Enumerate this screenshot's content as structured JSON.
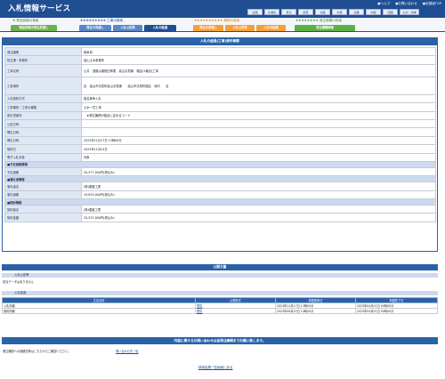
{
  "header": {
    "title": "入札情報サービス",
    "links": [
      "●ヘルプ",
      "●お問い合わせ",
      "●全国版TOP"
    ],
    "regions": [
      "全国",
      "北海道",
      "東北",
      "関東",
      "北陸",
      "中部",
      "近畿",
      "中国",
      "四国",
      "九州・沖縄"
    ]
  },
  "categories": {
    "heads": [
      "★ 物品役務の検索",
      "★★★★★★★★★ 工事の検索",
      "★★★★★★★★★★ 業務の検索",
      "★★★★★★★★ 発注機関の検索"
    ],
    "tabs": [
      "物品役務の発注見通し",
      "発注の見通し",
      "入札公告等",
      "入札の経過",
      "発注の見通し",
      "入札公告等",
      "入札の経過",
      "発注機関情報"
    ]
  },
  "main": {
    "heading": "入札の経過(工事)案件概要",
    "rows": [
      {
        "label": "発注機関",
        "value": "岐阜県"
      },
      {
        "label": "担当課・事務所",
        "value": "高山土木事務所"
      },
      {
        "label": "工事名称",
        "value": "公共　道路災害復旧事業　高山清見線　堀谷(1番目)工事"
      },
      {
        "label": "工事場所",
        "value": "自　高山市清見町高山清見線　　高山市清見町堀谷　地内　　至"
      },
      {
        "label": "入札契約方式",
        "value": "指名競争入札"
      },
      {
        "label": "工事種別／工事の種類",
        "value": "土木一式工事"
      },
      {
        "label": "設計書番号",
        "value": "　★発注機関が独自に定めるコード"
      },
      {
        "label": "公告日時",
        "value": ""
      },
      {
        "label": "開札日時",
        "value": ""
      },
      {
        "label": "開札日時",
        "value": "2023年11月17日 13時00分"
      },
      {
        "label": "契約日",
        "value": "2023年11月24日"
      },
      {
        "label": "電子入札対象",
        "value": "対象"
      }
    ],
    "section_price": "■予定価格情報",
    "price_label": "予定価格",
    "price_value": "20,577,000円(税込み)",
    "section_winner": "■落札者情報",
    "winner_rows": [
      {
        "label": "落札者名",
        "value": "(株)堀渡工業"
      },
      {
        "label": "落札価格",
        "value": "19,635,000円(税込み)"
      }
    ],
    "section_contract": "■契約情報",
    "contract_rows": [
      {
        "label": "契約者名",
        "value": "(株)堀渡工業"
      },
      {
        "label": "契約金額",
        "value": "20,537,000円(税込み)"
      }
    ]
  },
  "docs": {
    "heading": "公開文書",
    "notice_bar": "入札公告等",
    "notice_text": "該当データはありません",
    "result_bar": "入札経過",
    "columns": [
      "文書名称",
      "公開形式",
      "掲載更新日",
      "掲載終了日"
    ],
    "rows": [
      {
        "name": "入札情報",
        "format": "閲覧",
        "updated": "2023年11月17日 13時00分",
        "ends": "2025年04月01日 00時00分"
      },
      {
        "name": "契約情報",
        "format": "閲覧",
        "updated": "2023年06月22日 14時20分",
        "ends": "2025年04月01日 00時00分"
      }
    ]
  },
  "contact": {
    "heading": "内容に関するお問い合わせは各発注機関までお願い致します。",
    "text": "発注機関への連絡先等はこちらからご確認ください。",
    "link": "問い合わせ先一覧"
  },
  "back_link": "検索結果一覧画面に戻る"
}
